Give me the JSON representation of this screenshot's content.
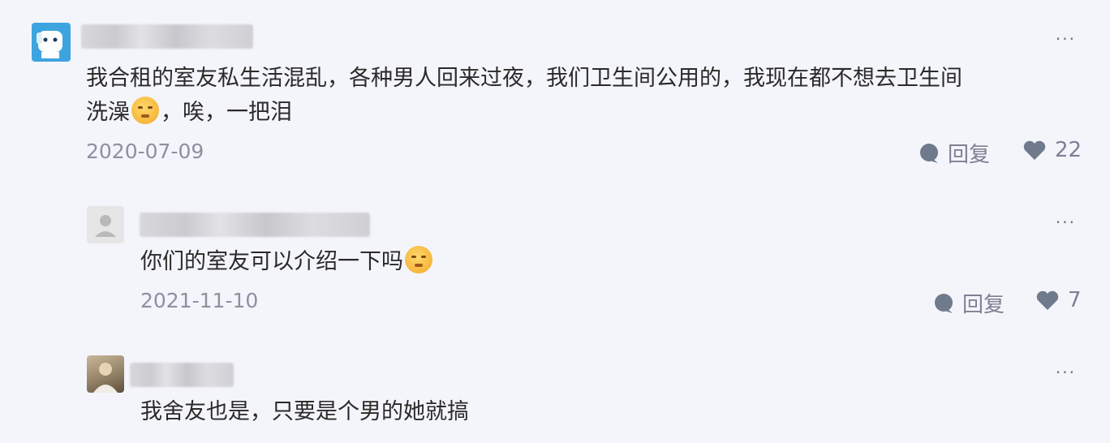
{
  "comments": [
    {
      "text_line1": "我合租的室友私生活混乱，各种男人回来过夜，我们卫生间公用的，我现在都不想去卫生间",
      "text_line2_before": "洗澡",
      "text_line2_after": "，唉，一把泪",
      "date": "2020-07-09",
      "reply_label": "回复",
      "likes": "22",
      "more": "···"
    },
    {
      "text_before": "你们的室友可以介绍一下吗",
      "date": "2021-11-10",
      "reply_label": "回复",
      "likes": "7",
      "more": "···"
    },
    {
      "text": "我舍友也是，只要是个男的她就搞",
      "more": "···"
    }
  ],
  "colors": {
    "background": "#f4f5fb",
    "muted": "#8d90a0",
    "icon": "#6f7a8c"
  }
}
